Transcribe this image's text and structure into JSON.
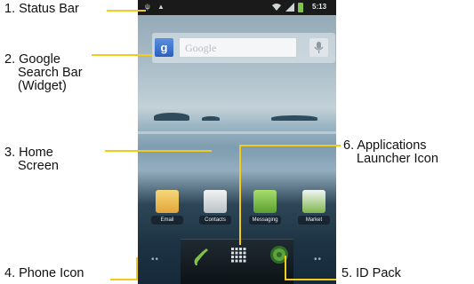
{
  "callouts": {
    "status_bar": "1. Status Bar",
    "google_search_bar": [
      "2. Google",
      "Search Bar",
      "(Widget)"
    ],
    "home_screen": [
      "3. Home",
      "Screen"
    ],
    "phone_icon": "4. Phone Icon",
    "id_pack": "5. ID Pack",
    "applications_launcher": [
      "6. Applications",
      "Launcher Icon"
    ]
  },
  "status_bar": {
    "time": "5:13"
  },
  "search_widget": {
    "placeholder": "Google"
  },
  "apps": [
    {
      "label": "Email",
      "icon": "email-icon",
      "color": "#f0c35a"
    },
    {
      "label": "Contacts",
      "icon": "contacts-icon",
      "color": "#dfe3e4"
    },
    {
      "label": "Messaging",
      "icon": "messaging-icon",
      "color": "#7cc04a"
    },
    {
      "label": "Market",
      "icon": "market-icon",
      "color": "#e6ecea"
    }
  ],
  "colors": {
    "leader_line": "#f2cb1d",
    "dock": "#0c1216"
  }
}
